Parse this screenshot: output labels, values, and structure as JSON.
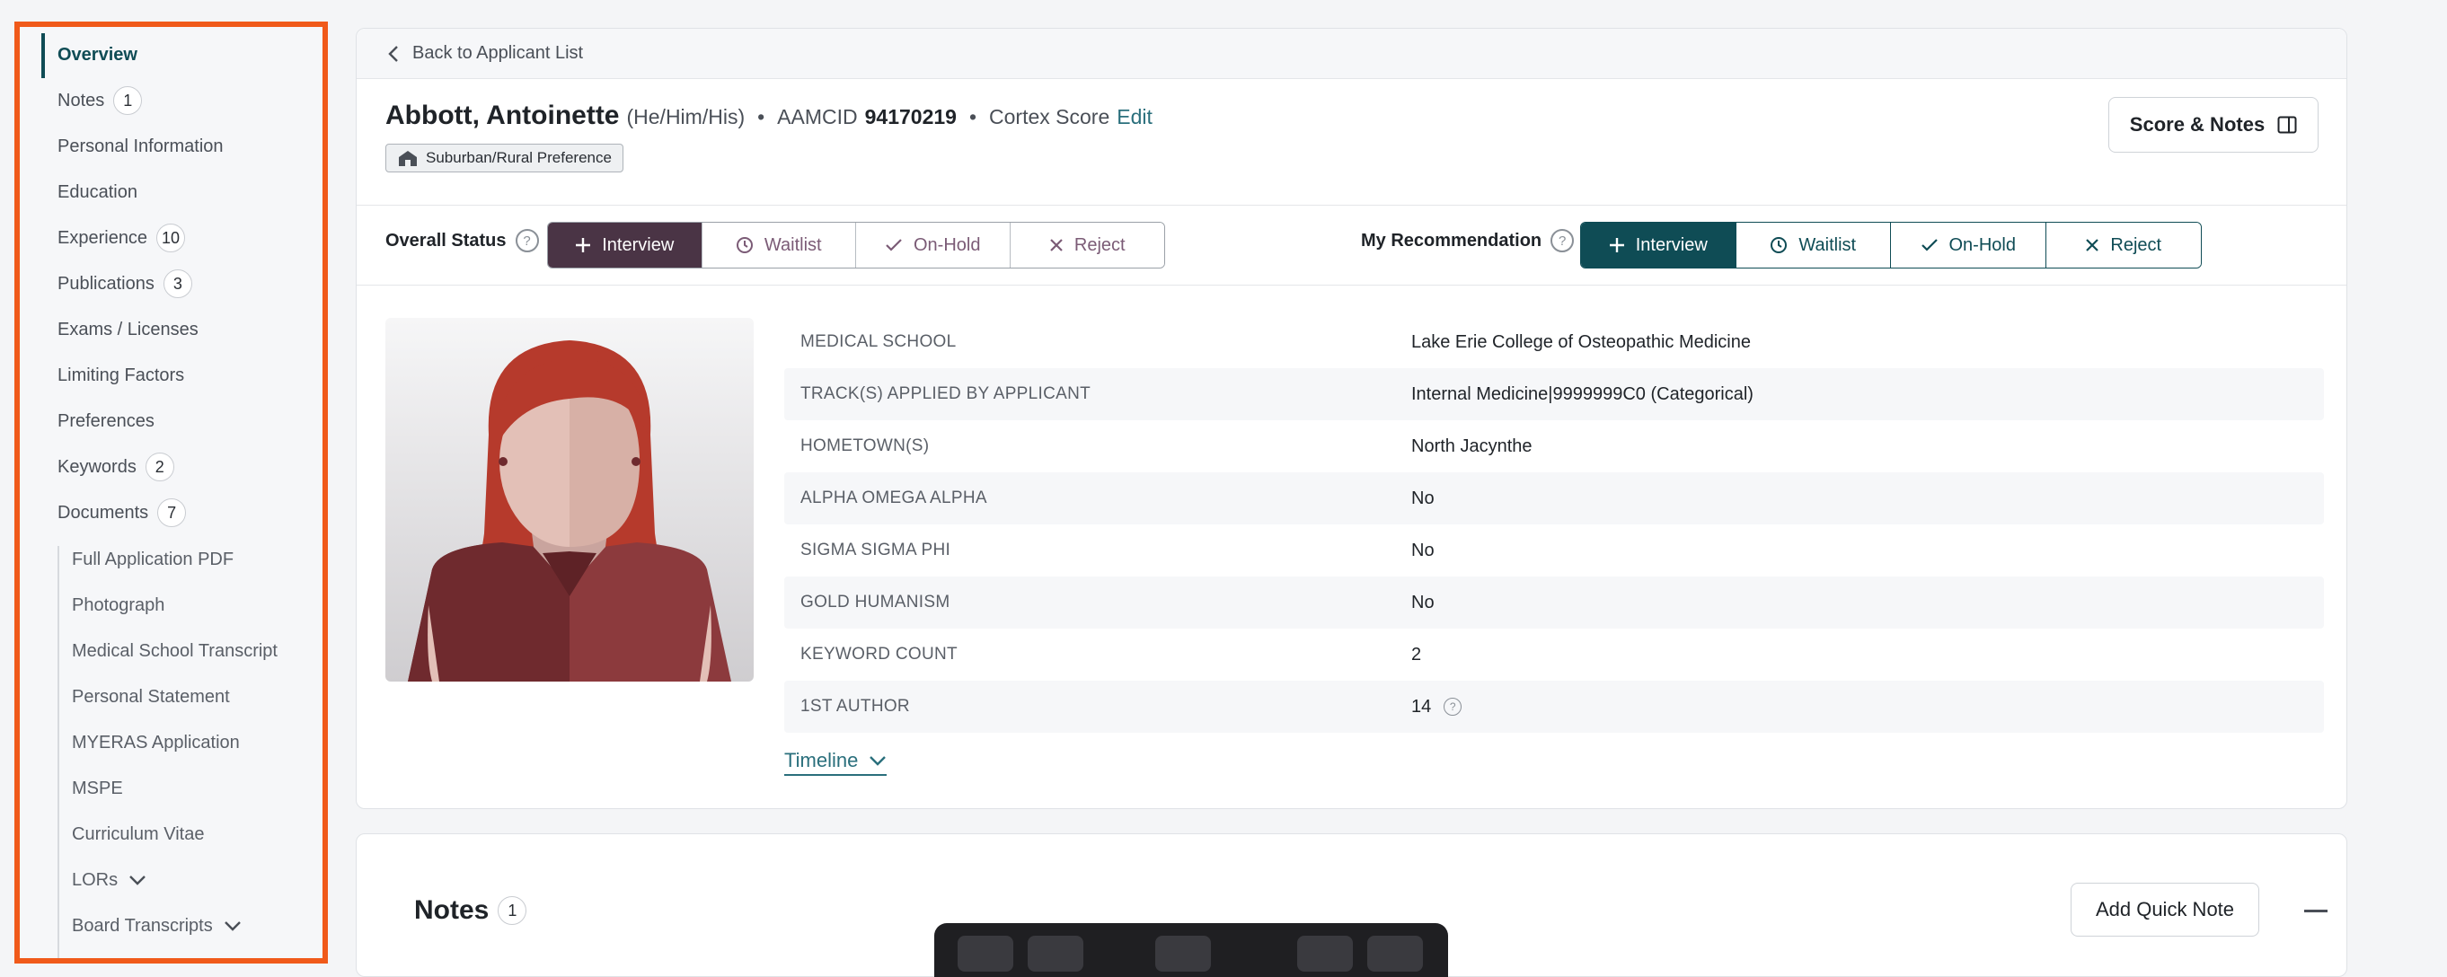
{
  "sidebar": {
    "items": [
      {
        "label": "Overview",
        "badge": ""
      },
      {
        "label": "Notes",
        "badge": "1"
      },
      {
        "label": "Personal Information",
        "badge": ""
      },
      {
        "label": "Education",
        "badge": ""
      },
      {
        "label": "Experience",
        "badge": "10"
      },
      {
        "label": "Publications",
        "badge": "3"
      },
      {
        "label": "Exams / Licenses",
        "badge": ""
      },
      {
        "label": "Limiting Factors",
        "badge": ""
      },
      {
        "label": "Preferences",
        "badge": ""
      },
      {
        "label": "Keywords",
        "badge": "2"
      },
      {
        "label": "Documents",
        "badge": "7"
      }
    ],
    "documents": [
      {
        "label": "Full Application PDF"
      },
      {
        "label": "Photograph"
      },
      {
        "label": "Medical School Transcript"
      },
      {
        "label": "Personal Statement"
      },
      {
        "label": "MYERAS Application"
      },
      {
        "label": "MSPE"
      },
      {
        "label": "Curriculum Vitae"
      },
      {
        "label": "LORs"
      },
      {
        "label": "Board Transcripts"
      }
    ]
  },
  "header": {
    "back_label": "Back to Applicant List",
    "name": "Abbott, Antoinette",
    "pronouns": "(He/Him/His)",
    "sep": "•",
    "aamcid_label": "AAMCID",
    "aamcid_value": "94170219",
    "cortex_label": "Cortex Score",
    "edit_label": "Edit",
    "pref_tag": "Suburban/Rural Preference",
    "score_notes_label": "Score & Notes"
  },
  "status": {
    "overall_label": "Overall Status",
    "mine_label": "My Recommendation",
    "help": "?",
    "options": [
      "Interview",
      "Waitlist",
      "On-Hold",
      "Reject"
    ],
    "overall_selected": "Interview",
    "mine_selected": "Interview",
    "colors": {
      "overall_active": "#4a3445",
      "mine_active": "#0f4c55"
    }
  },
  "info": [
    {
      "key": "MEDICAL SCHOOL",
      "value": "Lake Erie College of Osteopathic Medicine"
    },
    {
      "key": "TRACK(S) APPLIED BY APPLICANT",
      "value": "Internal Medicine|9999999C0 (Categorical)"
    },
    {
      "key": "HOMETOWN(S)",
      "value": "North Jacynthe"
    },
    {
      "key": "ALPHA OMEGA ALPHA",
      "value": "No"
    },
    {
      "key": "SIGMA SIGMA PHI",
      "value": "No"
    },
    {
      "key": "GOLD HUMANISM",
      "value": "No"
    },
    {
      "key": "KEYWORD COUNT",
      "value": "2"
    },
    {
      "key": "1ST AUTHOR",
      "value": "14"
    }
  ],
  "timeline_label": "Timeline",
  "notes": {
    "title": "Notes",
    "count": "1",
    "add_label": "Add Quick Note"
  }
}
